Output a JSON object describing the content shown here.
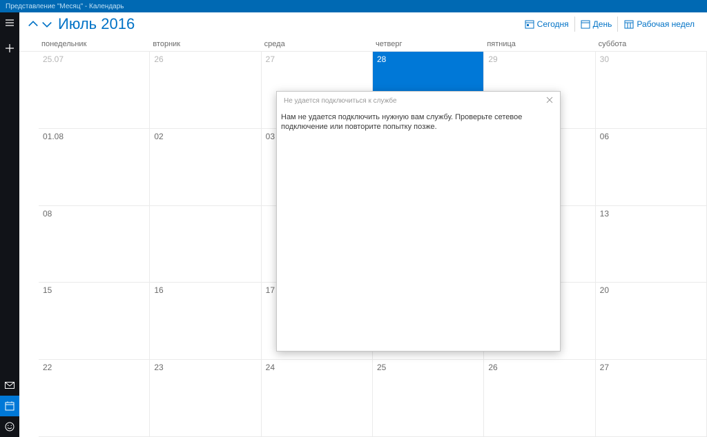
{
  "window": {
    "title": "Представление \"Месяц\" - Календарь"
  },
  "toolbar": {
    "month_title": "Июль 2016",
    "today": "Сегодня",
    "day": "День",
    "work_week": "Рабочая недел"
  },
  "dow": {
    "mon": "понедельник",
    "tue": "вторник",
    "wed": "среда",
    "thu": "четверг",
    "fri": "пятница",
    "sat": "суббота"
  },
  "cells": {
    "r0c0": "25.07",
    "r0c1": "26",
    "r0c2": "27",
    "r0c3": "28",
    "r0c4": "29",
    "r0c5": "30",
    "r1c0": "01.08",
    "r1c1": "02",
    "r1c2": "03",
    "r1c3": "",
    "r1c4": "",
    "r1c5": "06",
    "r2c0": "08",
    "r2c1": "",
    "r2c2": "",
    "r2c3": "",
    "r2c4": "",
    "r2c5": "13",
    "r3c0": "15",
    "r3c1": "16",
    "r3c2": "17",
    "r3c3": "",
    "r3c4": "",
    "r3c5": "20",
    "r4c0": "22",
    "r4c1": "23",
    "r4c2": "24",
    "r4c3": "25",
    "r4c4": "26",
    "r4c5": "27"
  },
  "dialog": {
    "title": "Не удается подключиться к службе",
    "body": "Нам не удается подключить нужную вам службу. Проверьте сетевое подключение или повторите попытку позже."
  }
}
